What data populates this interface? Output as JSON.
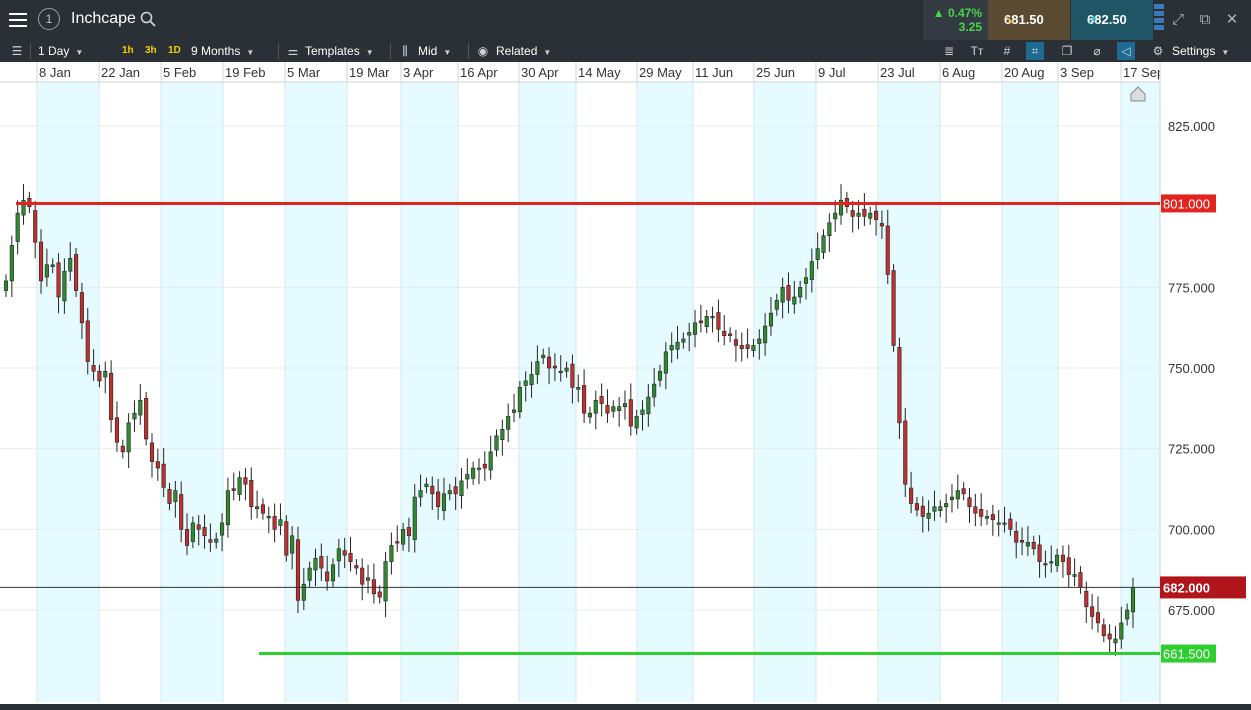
{
  "topbar": {
    "symbol": "Inchcape",
    "change_pct": "0.47%",
    "change_abs": "3.25",
    "sell_price": "681.50",
    "buy_price": "682.50",
    "info_label": "1",
    "icons": [
      "menu-icon",
      "info-icon",
      "search-icon",
      "depth-icon",
      "expand-icon",
      "popout-icon",
      "close-icon"
    ]
  },
  "toolbar": {
    "interval": "1 Day",
    "quick": [
      "1h",
      "3h",
      "1D"
    ],
    "period": "9 Months",
    "templates": "Templates",
    "price_type": "Mid",
    "related": "Related",
    "settings": "Settings"
  },
  "colors": {
    "up": "#2f8a2f",
    "down": "#c0302f",
    "resistance": "#e0251f",
    "support": "#2fce2f",
    "band": "#e6fbff",
    "bg": "#ffffff"
  },
  "chart_data": {
    "type": "candlestick",
    "x_tick_labels": [
      "8 Jan",
      "22 Jan",
      "5 Feb",
      "19 Feb",
      "5 Mar",
      "19 Mar",
      "3 Apr",
      "16 Apr",
      "30 Apr",
      "14 May",
      "29 May",
      "11 Jun",
      "25 Jun",
      "9 Jul",
      "23 Jul",
      "6 Aug",
      "20 Aug",
      "3 Sep",
      "17 Sep"
    ],
    "y_ticks": [
      "825.000",
      "775.000",
      "750.000",
      "725.000",
      "700.000",
      "675.000"
    ],
    "ylim": [
      650,
      840
    ],
    "horizontal_lines": [
      {
        "label": "801.000",
        "value": 801,
        "kind": "resistance"
      },
      {
        "label": "661.500",
        "value": 661.5,
        "kind": "support"
      }
    ],
    "current_price": {
      "label": "682.000",
      "value": 682
    },
    "closes": [
      777,
      788,
      798,
      802,
      800,
      789,
      777,
      782,
      782,
      772,
      780,
      784,
      774,
      764,
      752,
      749,
      746,
      749,
      734,
      727,
      724,
      733,
      736,
      740,
      728,
      721,
      719,
      713,
      708,
      712,
      700,
      695,
      702,
      700,
      698,
      696,
      697,
      702,
      712,
      712,
      716,
      714,
      707,
      707,
      705,
      704,
      700,
      703,
      692,
      698,
      678,
      683,
      688,
      691,
      688,
      684,
      689,
      694,
      692,
      690,
      688,
      683,
      685,
      680,
      679,
      690,
      695,
      696,
      700,
      698,
      710,
      712,
      714,
      711,
      707,
      711,
      712,
      711,
      715,
      717,
      719,
      719,
      719,
      724,
      729,
      731,
      735,
      737,
      744,
      746,
      748,
      752,
      754,
      750,
      750,
      749,
      750,
      744,
      744,
      736,
      736,
      740,
      739,
      736,
      738,
      738,
      739,
      732,
      735,
      737,
      741,
      745,
      749,
      755,
      757,
      758,
      759,
      761,
      764,
      764,
      766,
      766,
      762,
      760,
      760,
      757,
      756,
      756,
      757,
      759,
      763,
      767,
      771,
      775,
      771,
      772,
      775,
      778,
      783,
      787,
      791,
      795,
      798,
      802,
      800,
      797,
      798,
      797,
      798,
      796,
      794,
      779,
      757,
      733,
      714,
      708,
      706,
      704,
      705,
      707,
      707,
      708,
      710,
      712,
      711,
      707,
      705,
      704,
      704,
      703,
      702,
      702,
      700,
      696,
      696,
      696,
      694,
      690,
      689,
      690,
      692,
      690,
      686,
      686,
      682,
      676,
      673,
      671,
      667,
      666,
      666,
      671,
      675,
      682
    ],
    "price_summary": {
      "period_high": 825,
      "period_low": 661.5,
      "last": 682
    }
  }
}
